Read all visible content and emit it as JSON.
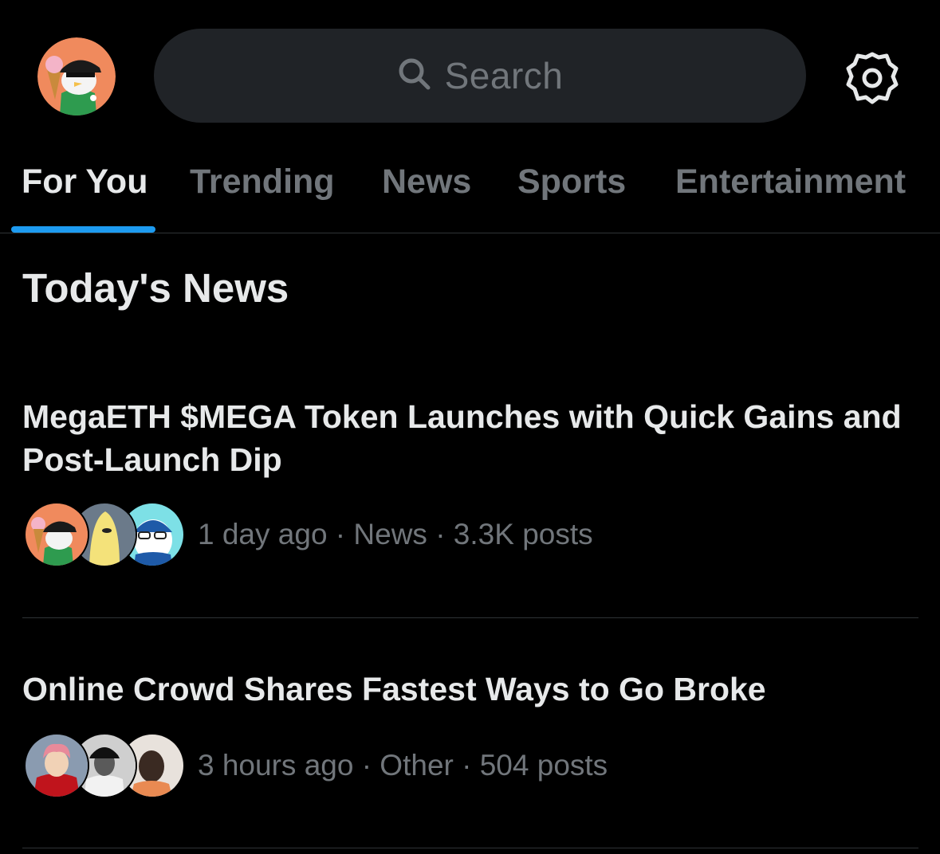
{
  "header": {
    "search_placeholder": "Search",
    "avatar_icon": "profile-avatar-icon",
    "settings_icon": "gear-icon"
  },
  "tabs": [
    {
      "label": "For You",
      "active": true
    },
    {
      "label": "Trending",
      "active": false
    },
    {
      "label": "News",
      "active": false
    },
    {
      "label": "Sports",
      "active": false
    },
    {
      "label": "Entertainment",
      "active": false
    }
  ],
  "section": {
    "title": "Today's News"
  },
  "stories": [
    {
      "title": "MegaETH $MEGA Token Launches with Quick Gains and Post-Launch Dip",
      "meta": "1 day ago · News · 3.3K posts"
    },
    {
      "title": "Online Crowd Shares Fastest Ways to Go Broke",
      "meta": "3 hours ago · Other · 504 posts"
    }
  ],
  "colors": {
    "accent": "#1d9bf0",
    "background": "#000000",
    "text_primary": "#e7e9ea",
    "text_secondary": "#71767b",
    "search_bg": "#202327"
  }
}
